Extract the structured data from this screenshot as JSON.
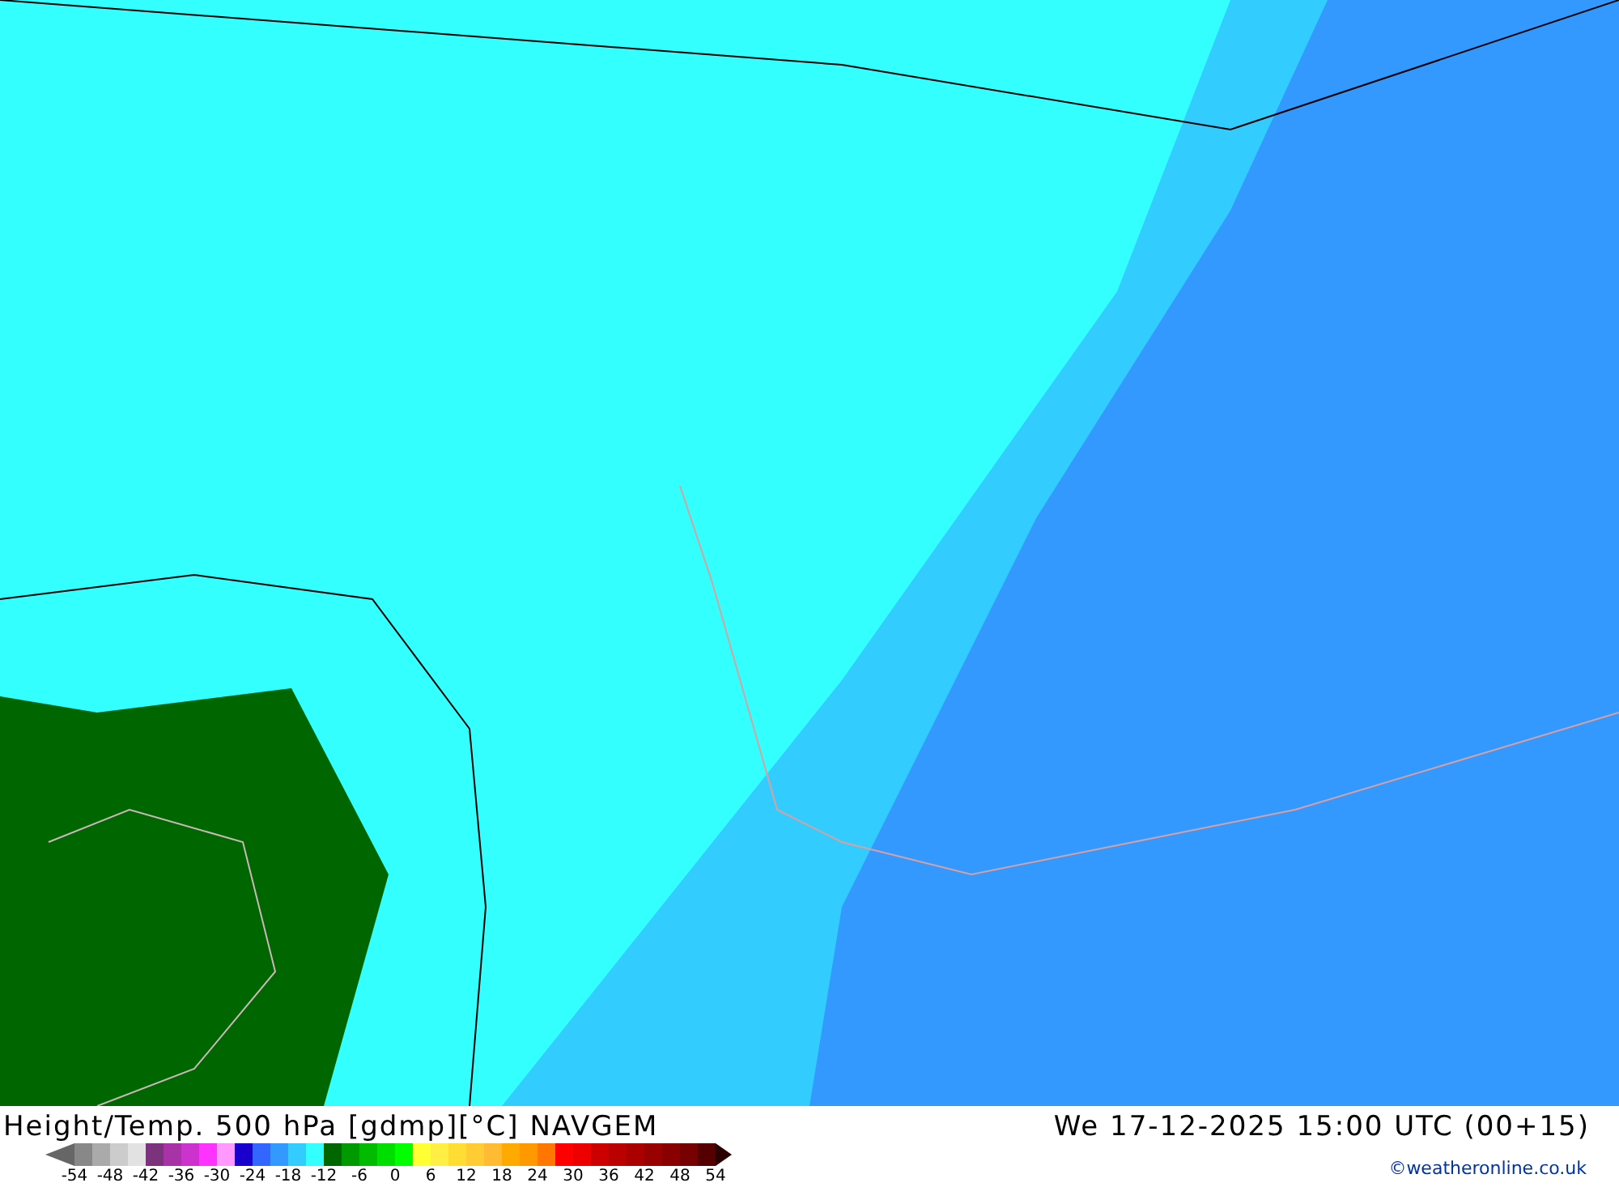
{
  "title": "Height/Temp. 500 hPa [gdmp][°C] NAVGEM",
  "valid_time": "We 17-12-2025 15:00 UTC (00+15)",
  "legend": {
    "colors": [
      {
        "color": "#888888"
      },
      {
        "color": "#aaaaaa"
      },
      {
        "color": "#cccccc"
      },
      {
        "color": "#e2e2e2"
      },
      {
        "color": "#7b337b"
      },
      {
        "color": "#a733a7"
      },
      {
        "color": "#cc33cc"
      },
      {
        "color": "#ff33ff"
      },
      {
        "color": "#ff99ff"
      },
      {
        "color": "#1a00cc"
      },
      {
        "color": "#3366ff"
      },
      {
        "color": "#3399ff"
      },
      {
        "color": "#33ccff"
      },
      {
        "color": "#33ffff"
      },
      {
        "color": "#006600"
      },
      {
        "color": "#009900"
      },
      {
        "color": "#00bb00"
      },
      {
        "color": "#00dd00"
      },
      {
        "color": "#00ff00"
      },
      {
        "color": "#ffff33"
      },
      {
        "color": "#ffee44"
      },
      {
        "color": "#ffdd33"
      },
      {
        "color": "#ffcc33"
      },
      {
        "color": "#ffbb33"
      },
      {
        "color": "#ffaa00"
      },
      {
        "color": "#ff9900"
      },
      {
        "color": "#ff7700"
      },
      {
        "color": "#ff0000"
      },
      {
        "color": "#ee0000"
      },
      {
        "color": "#cc0000"
      },
      {
        "color": "#bb0000"
      },
      {
        "color": "#aa0000"
      },
      {
        "color": "#990000"
      },
      {
        "color": "#880000"
      },
      {
        "color": "#770000"
      },
      {
        "color": "#550000"
      }
    ],
    "ticks": [
      "-54",
      "-48",
      "-42",
      "-36",
      "-30",
      "-24",
      "-18",
      "-12",
      "-6",
      "0",
      "6",
      "12",
      "18",
      "24",
      "30",
      "36",
      "42",
      "48",
      "54"
    ]
  },
  "credit": "©weatheronline.co.uk"
}
